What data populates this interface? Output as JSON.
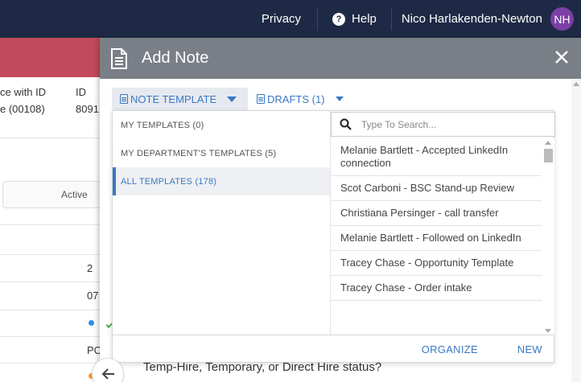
{
  "topbar": {
    "privacy": "Privacy",
    "help": "Help",
    "user_name": "Nico Harlakenden-Newton",
    "avatar_initials": "NH"
  },
  "background": {
    "col_header_1": "ce with ID",
    "col_header_2": "ID",
    "cell_1": "e (00108)",
    "cell_2": "8091",
    "tab_active": "Active",
    "row_values": [
      "2",
      "07",
      "PC"
    ],
    "behind_text": "Temp-Hire, Temporary, or Direct Hire status?"
  },
  "modal": {
    "title": "Add Note",
    "note_template_label": "NOTE TEMPLATE",
    "drafts_label": "DRAFTS (1)"
  },
  "dropdown": {
    "categories": [
      {
        "label": "MY TEMPLATES (0)"
      },
      {
        "label": "MY DEPARTMENT'S TEMPLATES (5)"
      },
      {
        "label": "ALL TEMPLATES (178)"
      }
    ],
    "search_placeholder": "Type To Search...",
    "templates": [
      {
        "label": "Melanie Bartlett - Accepted LinkedIn connection"
      },
      {
        "label": "Scot Carboni - BSC Stand-up Review"
      },
      {
        "label": "Christiana Persinger - call transfer"
      },
      {
        "label": "Melanie Bartlett - Followed on LinkedIn"
      },
      {
        "label": "Tracey Chase - Opportunity Template"
      },
      {
        "label": "Tracey Chase - Order intake"
      }
    ],
    "organize_label": "ORGANIZE",
    "new_label": "NEW"
  },
  "colors": {
    "topbar_bg": "#1e2a45",
    "accent": "#3a78c3",
    "avatar_bg": "#7b3fa6",
    "modal_header_bg": "#7a7f87",
    "banner": "#c24a5a"
  }
}
